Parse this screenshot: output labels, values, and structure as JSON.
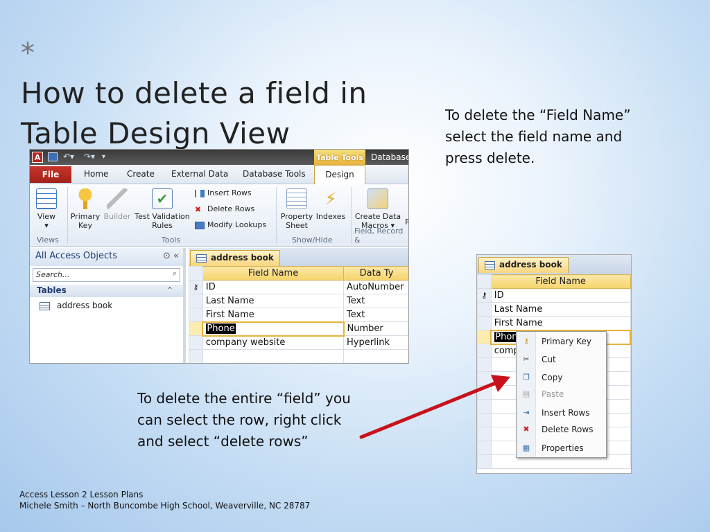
{
  "slide": {
    "bullet": "*",
    "title": "How to delete a field in Table Design View",
    "note_right": "To delete the “Field Name” select the field name and press delete.",
    "note_left": "To delete the entire “field” you can select the row, right click and select “delete rows”",
    "footer_line1": "Access Lesson 2 Lesson Plans",
    "footer_line2": "Michele Smith – North Buncombe High School, Weaverville, NC  28787"
  },
  "app": {
    "app_icon": "A",
    "table_tools": "Table Tools",
    "db_title": "Database",
    "tabs": [
      "File",
      "Home",
      "Create",
      "External Data",
      "Database Tools",
      "Design"
    ],
    "ribbon": {
      "view": "View",
      "primary_key_1": "Primary",
      "primary_key_2": "Key",
      "builder": "Builder",
      "test_1": "Test Validation",
      "test_2": "Rules",
      "insert_rows": "Insert Rows",
      "delete_rows": "Delete Rows",
      "modify_lookups": "Modify Lookups",
      "property_1": "Property",
      "property_2": "Sheet",
      "indexes": "Indexes",
      "create_data_1": "Create Data",
      "create_data_2": "Macros",
      "rename_partial": "R",
      "group_views": "Views",
      "group_tools": "Tools",
      "group_showhide": "Show/Hide",
      "group_field": "Field, Record &"
    },
    "nav": {
      "header": "All Access Objects",
      "search_placeholder": "Search...",
      "section": "Tables",
      "item": "address book"
    },
    "doc_tab": "address book",
    "columns": [
      "Field Name",
      "Data Ty"
    ],
    "rows": [
      {
        "name": "ID",
        "type": "AutoNumber",
        "key": true
      },
      {
        "name": "Last Name",
        "type": "Text"
      },
      {
        "name": "First Name",
        "type": "Text"
      },
      {
        "name": "Phone",
        "type": "Number"
      },
      {
        "name": "company website",
        "type": "Hyperlink"
      }
    ]
  },
  "zoom": {
    "doc_tab": "address book",
    "column": "Field Name",
    "rows": [
      "ID",
      "Last Name",
      "First Name",
      "Phon",
      "comp"
    ],
    "menu": [
      {
        "label": "Primary Key",
        "icon": "key-icon",
        "disabled": false
      },
      {
        "label": "Cut",
        "icon": "scissors-icon",
        "disabled": false
      },
      {
        "label": "Copy",
        "icon": "copy-icon",
        "disabled": false
      },
      {
        "label": "Paste",
        "icon": "paste-icon",
        "disabled": true
      },
      {
        "label": "Insert Rows",
        "icon": "insert-rows-icon",
        "disabled": false
      },
      {
        "label": "Delete Rows",
        "icon": "delete-rows-icon",
        "disabled": false
      },
      {
        "label": "Properties",
        "icon": "properties-icon",
        "disabled": false
      }
    ]
  },
  "colors": {
    "accent_red": "#c8121b",
    "file_tab": "#b5261e",
    "header_gold": "#f6d36a"
  }
}
